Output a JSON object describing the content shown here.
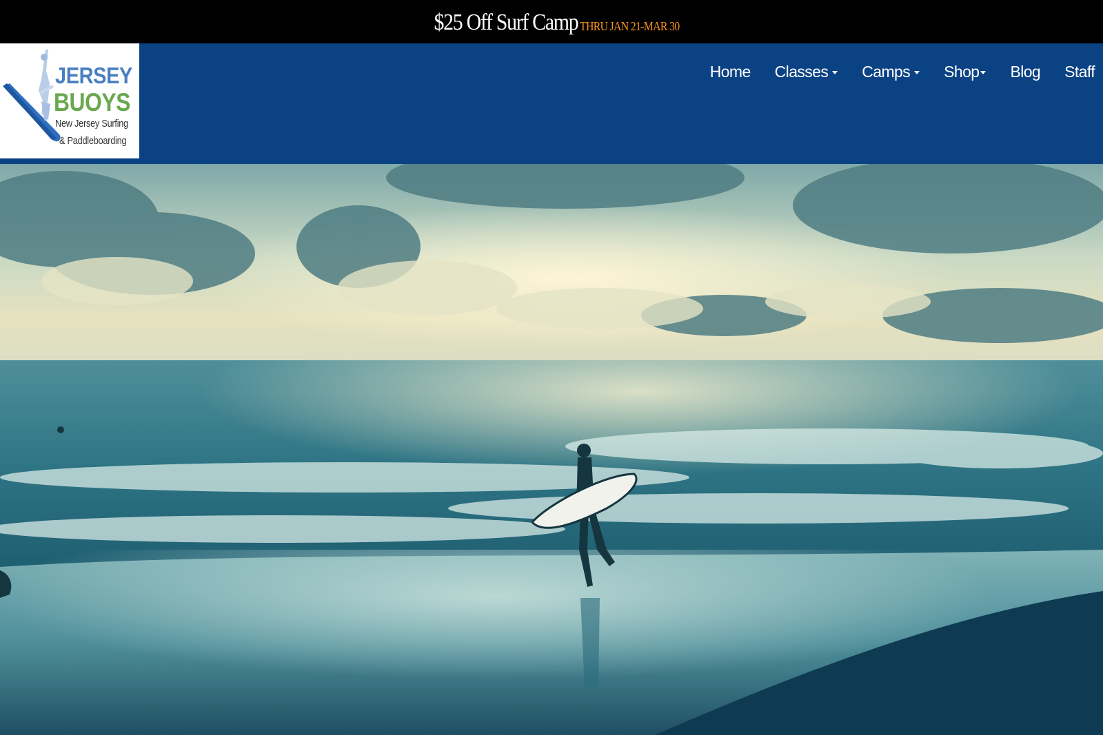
{
  "promo": {
    "headline": "$25 Off Surf Camp",
    "dates": "THRU JAN 21-MAR 30",
    "headline_color": "#ffffff",
    "dates_color": "#f7941d"
  },
  "logo": {
    "word1": "JERSEY",
    "word2": "BUOYS",
    "tagline1": "New Jersey Surfing",
    "tagline2": "& Paddleboarding",
    "word1_color": "#4a7fc1",
    "word2_color": "#6aa84f"
  },
  "nav": {
    "items": [
      {
        "label": "Home",
        "has_dropdown": false
      },
      {
        "label": "Classes",
        "has_dropdown": true
      },
      {
        "label": "Camps",
        "has_dropdown": true
      },
      {
        "label": "Shop",
        "has_dropdown": true
      },
      {
        "label": "Blog",
        "has_dropdown": false
      },
      {
        "label": "Staff",
        "has_dropdown": false
      }
    ]
  },
  "colors": {
    "header_bg": "#0b4283",
    "promo_bg": "#000000"
  },
  "hero": {
    "image": "surfer-at-sunrise-beach"
  }
}
